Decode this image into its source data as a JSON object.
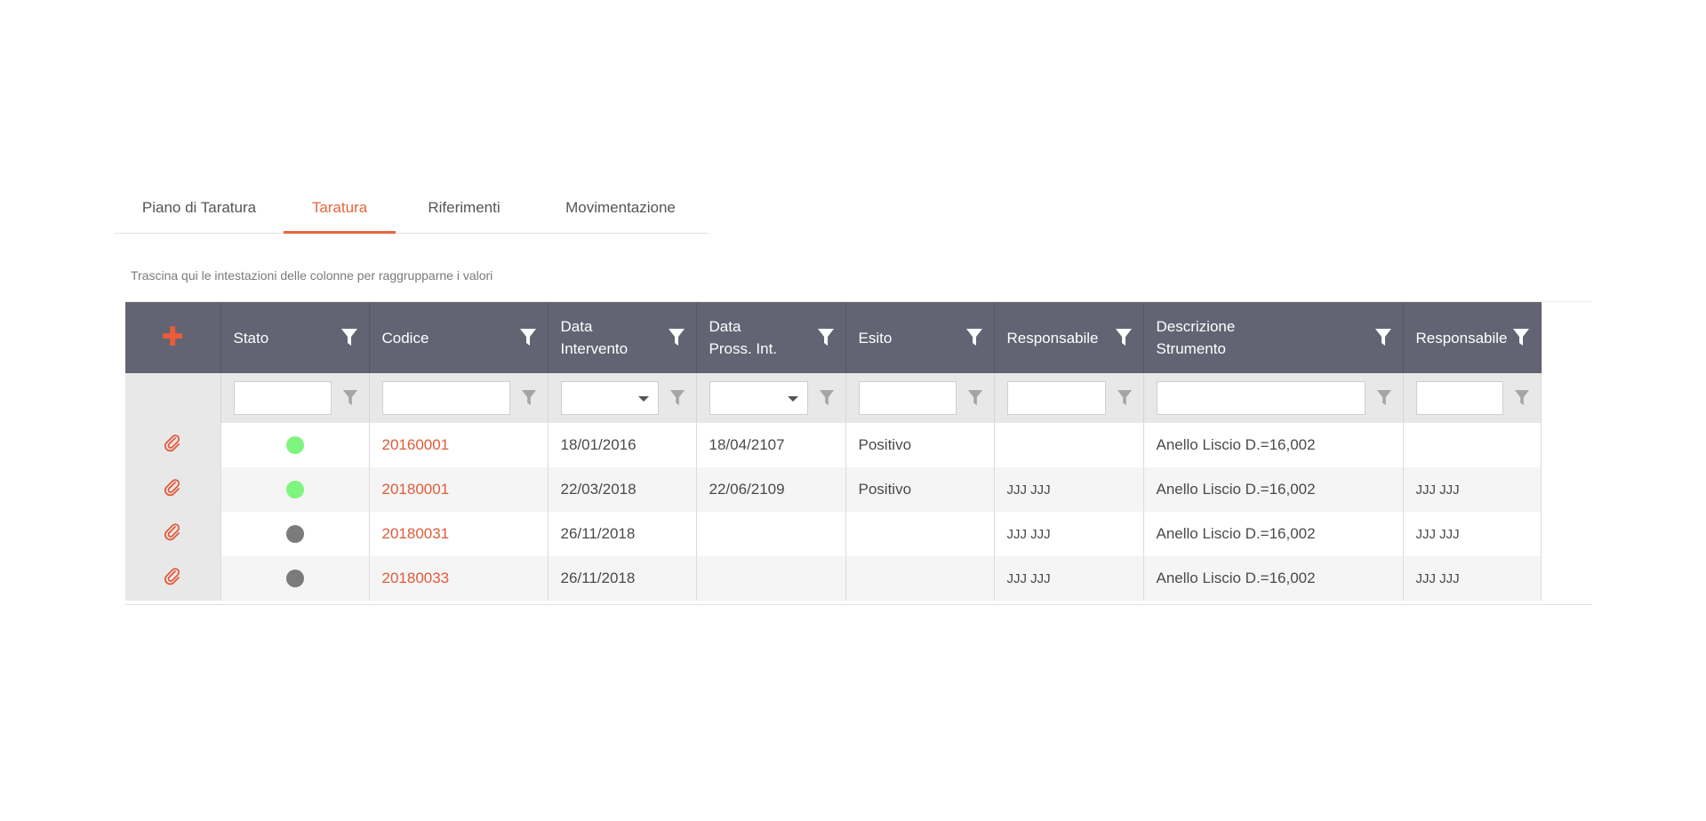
{
  "tabs": [
    {
      "label": "Piano di Taratura",
      "active": false
    },
    {
      "label": "Taratura",
      "active": true
    },
    {
      "label": "Riferimenti",
      "active": false
    },
    {
      "label": "Movimentazione",
      "active": false
    }
  ],
  "group_hint": "Trascina qui le intestazioni delle colonne per raggrupparne i valori",
  "grid": {
    "add_icon": "plus-icon",
    "columns": [
      {
        "line1": "Stato",
        "line2": ""
      },
      {
        "line1": "Codice",
        "line2": ""
      },
      {
        "line1": "Data",
        "line2": "Intervento"
      },
      {
        "line1": "Data",
        "line2": "Pross. Int."
      },
      {
        "line1": "Esito",
        "line2": ""
      },
      {
        "line1": "Responsabile",
        "line2": ""
      },
      {
        "line1": "Descrizione",
        "line2": "Strumento"
      },
      {
        "line1": "Responsabile",
        "line2": ""
      }
    ],
    "rows": [
      {
        "stato_color": "#7ef57e",
        "codice": "20160001",
        "data_intervento": "18/01/2016",
        "data_pross": "18/04/2107",
        "esito": "Positivo",
        "responsabile": "",
        "descrizione": "Anello Liscio D.=16,002",
        "responsabile2": ""
      },
      {
        "stato_color": "#7ef57e",
        "codice": "20180001",
        "data_intervento": "22/03/2018",
        "data_pross": "22/06/2109",
        "esito": "Positivo",
        "responsabile": "JJJ JJJ",
        "descrizione": "Anello Liscio D.=16,002",
        "responsabile2": "JJJ JJJ"
      },
      {
        "stato_color": "#7b7b7b",
        "codice": "20180031",
        "data_intervento": "26/11/2018",
        "data_pross": "",
        "esito": "",
        "responsabile": "JJJ JJJ",
        "descrizione": "Anello Liscio D.=16,002",
        "responsabile2": "JJJ JJJ"
      },
      {
        "stato_color": "#7b7b7b",
        "codice": "20180033",
        "data_intervento": "26/11/2018",
        "data_pross": "",
        "esito": "",
        "responsabile": "JJJ JJJ",
        "descrizione": "Anello Liscio D.=16,002",
        "responsabile2": "JJJ JJJ"
      }
    ]
  },
  "colors": {
    "accent": "#e7663f",
    "header_bg": "#626473",
    "status_green": "#7ef57e",
    "status_gray": "#7b7b7b"
  }
}
